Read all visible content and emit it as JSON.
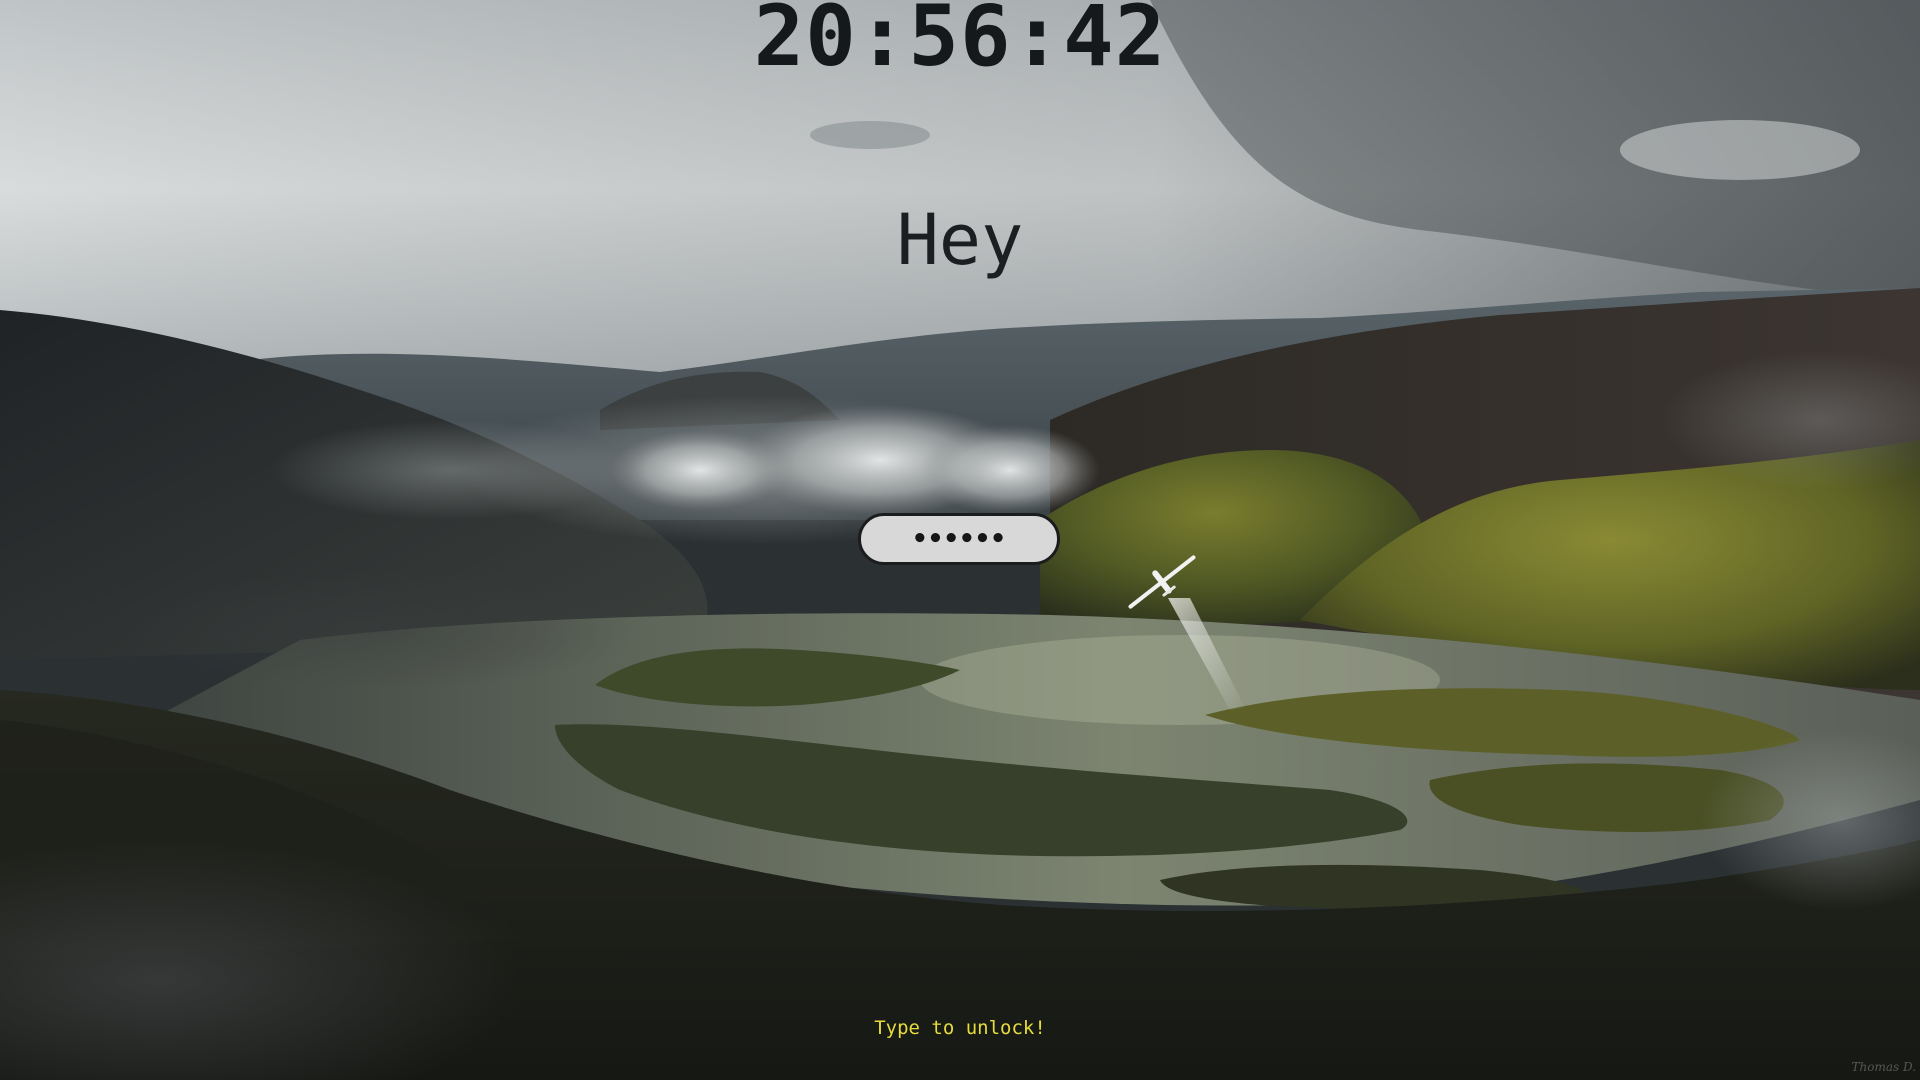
{
  "lock_screen": {
    "clock": "20:56:42",
    "greeting": "Hey",
    "password_mask": "••••••",
    "hint": "Type to unlock!"
  },
  "colors": {
    "hint_text": "#e6dc3c",
    "input_background": "#d8d8d8",
    "input_border": "#1a1c1d",
    "text_dark": "#16191b"
  },
  "wallpaper": {
    "subject": "misty mountain valley with river and glider"
  }
}
